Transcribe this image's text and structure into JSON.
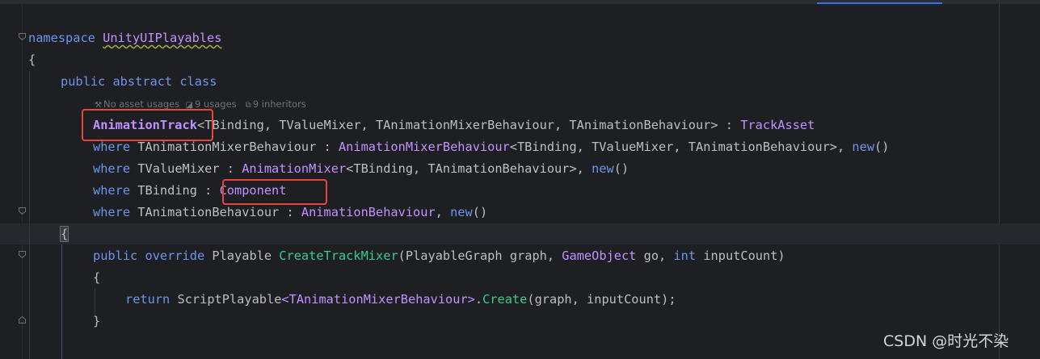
{
  "editor": {
    "lines": {
      "l1": {
        "kw": "namespace",
        "name": "UnityUIPlayables"
      },
      "l2": {
        "brace": "{"
      },
      "l3": {
        "text": "public abstract class"
      },
      "hint": {
        "usages_asset": "No asset usages",
        "usages": "9 usages",
        "inheritors": "9 inheritors"
      },
      "l4": {
        "class_name": "AnimationTrack",
        "generic": "<TBinding, TValueMixer, TAnimationMixerBehaviour, TAnimationBehaviour> : ",
        "base": "TrackAsset"
      },
      "l5": {
        "kw": "where",
        "a": " TAnimationMixerBehaviour : ",
        "b": "AnimationMixerBehaviour",
        "c": "<TBinding, TValueMixer, TAnimationBehaviour>, ",
        "new": "new",
        "end": "()"
      },
      "l6": {
        "kw": "where",
        "a": " TValueMixer : ",
        "b": "AnimationMixer",
        "c": "<TBinding, TAnimationBehaviour>, ",
        "new": "new",
        "end": "()"
      },
      "l7": {
        "kw": "where",
        "a": " TBinding : ",
        "b": "Component"
      },
      "l8": {
        "kw": "where",
        "a": " TAnimationBehaviour : ",
        "b": "AnimationBehaviour",
        "c": ", ",
        "new": "new",
        "end": "()"
      },
      "l9": {
        "brace": "{"
      },
      "l10": {
        "kw1": "public",
        "kw2": "override",
        "type": "Playable",
        "method": "CreateTrackMixer",
        "p1type": "PlayableGraph",
        "p1": " graph, ",
        "p2type": "GameObject",
        "p2": " go, ",
        "p3type": "int",
        "p3": " inputCount)"
      },
      "l11": {
        "brace": "{"
      },
      "l12": {
        "kw": "return",
        "type": "ScriptPlayable",
        "generic": "<TAnimationMixerBehaviour>",
        "dot": ".",
        "method": "Create",
        "args": "(graph, inputCount);"
      },
      "l13": {
        "brace": "}"
      }
    }
  },
  "watermark": "CSDN @时光不染"
}
